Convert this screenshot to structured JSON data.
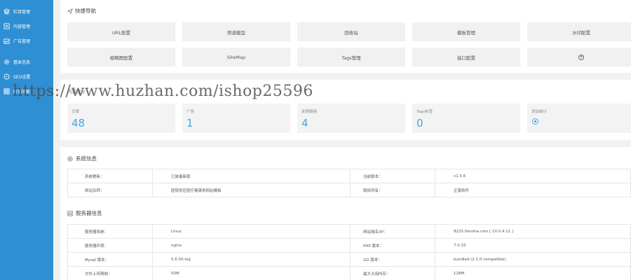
{
  "sidebar": {
    "items": [
      {
        "label": "栏目管理",
        "icon": "layers-icon"
      },
      {
        "label": "内容管理",
        "icon": "document-icon"
      },
      {
        "label": "广告管理",
        "icon": "image-icon"
      },
      {
        "label": "基本信息",
        "icon": "gear-icon"
      },
      {
        "label": "SEO设置",
        "icon": "compass-icon"
      },
      {
        "label": "附加功能",
        "icon": "grid-icon"
      }
    ]
  },
  "quick_nav": {
    "title": "快捷导航",
    "buttons": [
      "URL配置",
      "频道模型",
      "回收站",
      "模板管理",
      "水印配置",
      "缩略图配置",
      "SiteMap",
      "Tags管理",
      "接口配置"
    ]
  },
  "stats": {
    "title": "内容统计",
    "cards": [
      {
        "label": "文章",
        "value": "48"
      },
      {
        "label": "广告",
        "value": "1"
      },
      {
        "label": "友情链接",
        "value": "4"
      },
      {
        "label": "Tags标签",
        "value": "0"
      }
    ],
    "add_label": "添加统计"
  },
  "system_info": {
    "title": "系统信息",
    "rows": [
      [
        "系统更新：",
        "已是最新版",
        "当前版本：",
        "v1.5.6"
      ],
      [
        "网站名称：",
        "医院供应医疗健康类网站模板",
        "版权所有：",
        "正版软件"
      ]
    ]
  },
  "server_info": {
    "title": "服务器信息",
    "rows": [
      [
        "服务器系统：",
        "Linux",
        "网站域名/IP：",
        "8225.ifanzha.com [ 10.0.4.11 ]"
      ],
      [
        "服务器环境：",
        "nginx",
        "PHP 版本：",
        "7.0.33"
      ],
      [
        "Mysql 版本：",
        "5.6.50-log",
        "GD 版本：",
        "bundled (2.1.0 compatible)"
      ],
      [
        "文件上传限制：",
        "50M",
        "最大占用内存：",
        "128M"
      ]
    ]
  },
  "watermark": "https://www.huzhan.com/ishop25596",
  "colors": {
    "sidebar": "#2f8fd4",
    "accent": "#3fa9e2",
    "background": "#f1f1f1"
  }
}
